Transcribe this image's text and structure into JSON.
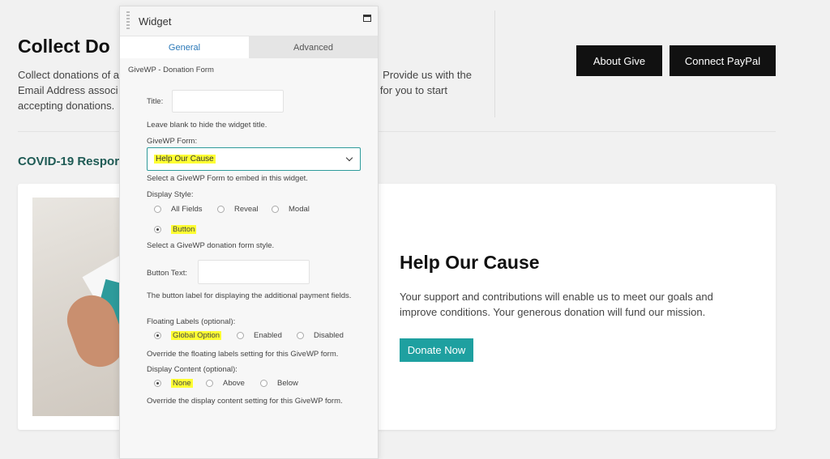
{
  "page": {
    "title": "Collect Do",
    "intro_line1_left": "Collect donations of a",
    "intro_line1_right": "Provide us with the",
    "intro_line2_left": "Email Address associ",
    "intro_line2_right": "for you to start",
    "intro_line3": "accepting donations.",
    "about_button": "About Give",
    "paypal_button": "Connect PayPal",
    "section_heading": "COVID-19 Respor"
  },
  "card": {
    "title": "Help Our Cause",
    "description": "Your support and contributions will enable us to meet our goals and improve conditions. Your generous donation will fund our mission.",
    "donate_button": "Donate Now"
  },
  "widget": {
    "title": "Widget",
    "tabs": [
      {
        "label": "General"
      },
      {
        "label": "Advanced"
      }
    ],
    "form_heading": "GiveWP - Donation Form",
    "title_label": "Title:",
    "title_value": "",
    "title_help": "Leave blank to hide the widget title.",
    "form_label": "GiveWP Form:",
    "form_selected": "Help Our Cause",
    "form_help": "Select a GiveWP Form to embed in this widget.",
    "display_style_label": "Display Style:",
    "display_style_options": [
      "All Fields",
      "Reveal",
      "Modal",
      "Button"
    ],
    "display_style_selected": "Button",
    "display_style_help": "Select a GiveWP donation form style.",
    "button_text_label": "Button Text:",
    "button_text_value": "",
    "button_text_help": "The button label for displaying the additional payment fields.",
    "floating_labels_label": "Floating Labels (optional):",
    "floating_labels_options": [
      "Global Option",
      "Enabled",
      "Disabled"
    ],
    "floating_labels_selected": "Global Option",
    "floating_labels_help": "Override the floating labels setting for this GiveWP form.",
    "display_content_label": "Display Content (optional):",
    "display_content_options": [
      "None",
      "Above",
      "Below"
    ],
    "display_content_selected": "None",
    "display_content_help": "Override the display content setting for this GiveWP form."
  },
  "colors": {
    "accent_teal": "#1ea0a0",
    "tab_active": "#2a78b8",
    "highlight": "#ffff33",
    "dark_button": "#111111"
  }
}
